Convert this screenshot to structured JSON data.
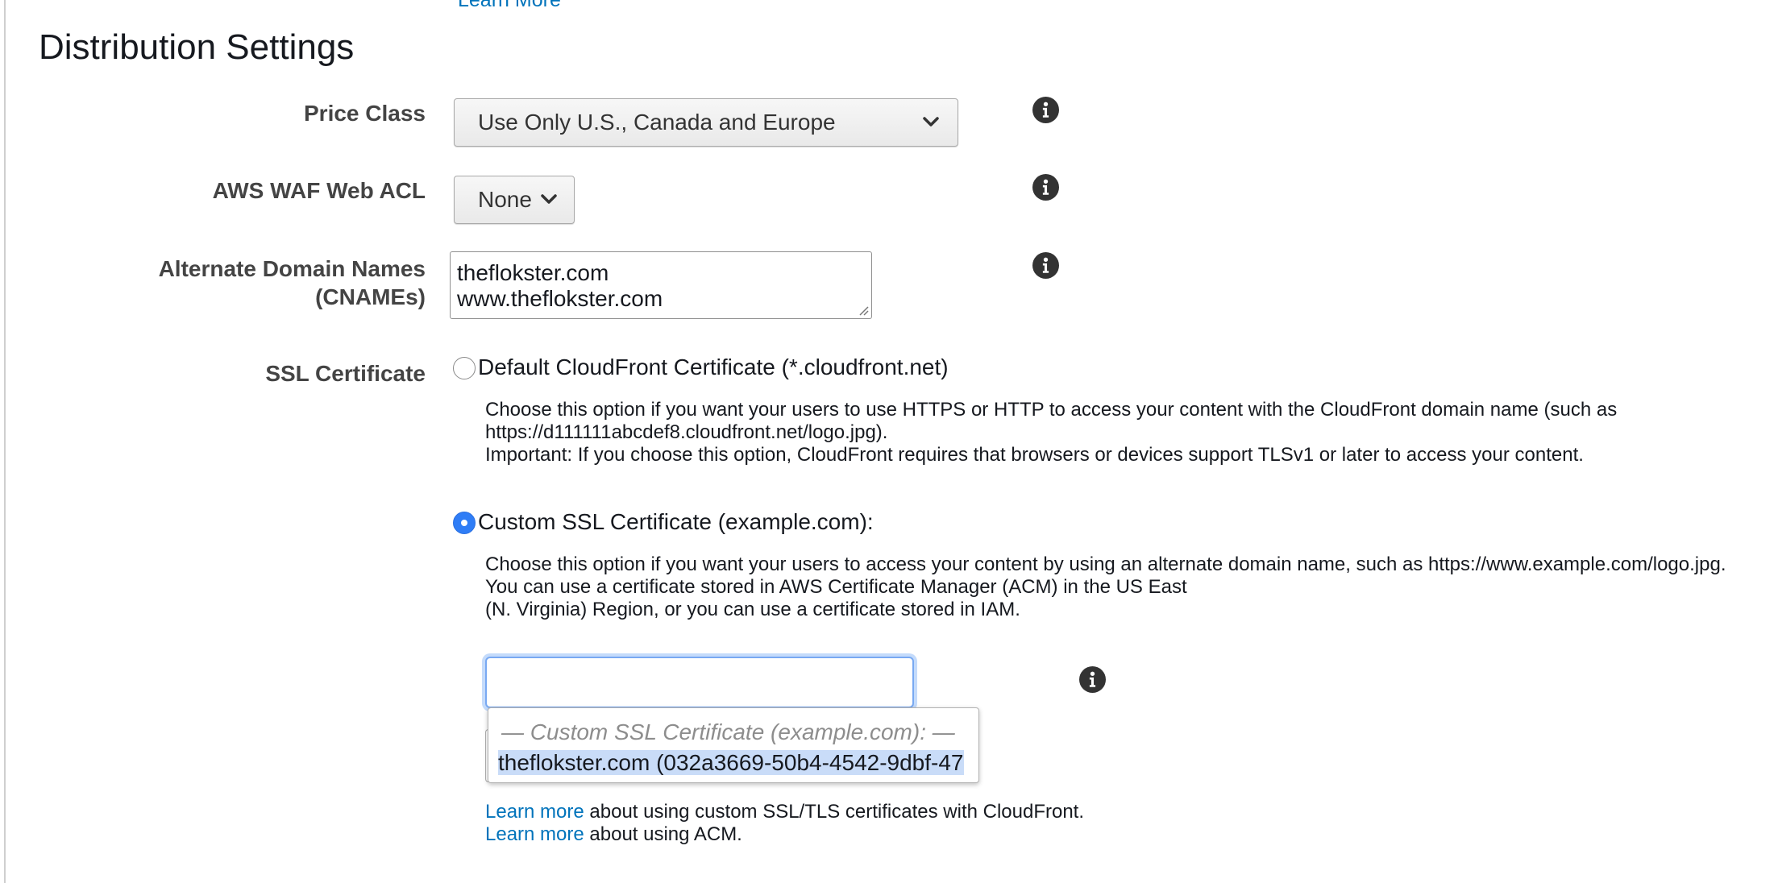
{
  "top_link": "Learn More",
  "section_title": "Distribution Settings",
  "price_class": {
    "label": "Price Class",
    "value": "Use Only U.S., Canada and Europe"
  },
  "waf": {
    "label": "AWS WAF Web ACL",
    "value": "None"
  },
  "cnames": {
    "label_line1": "Alternate Domain Names",
    "label_line2": "(CNAMEs)",
    "line1": "theflokster.com",
    "line2": "www.theflokster.com"
  },
  "ssl": {
    "label": "SSL Certificate",
    "default_option": {
      "label": "Default CloudFront Certificate (*.cloudfront.net)",
      "selected": false,
      "desc_line1": "Choose this option if you want your users to use HTTPS or HTTP to access your content with the CloudFront domain name (such as",
      "desc_line2": "https://d111111abcdef8.cloudfront.net/logo.jpg).",
      "desc_line3": "Important: If you choose this option, CloudFront requires that browsers or devices support TLSv1 or later to access your content."
    },
    "custom_option": {
      "label": "Custom SSL Certificate (example.com):",
      "selected": true,
      "desc_line1": "Choose this option if you want your users to access your content by using an alternate domain name, such as https://www.example.com/logo.jpg.",
      "desc_line2": "You can use a certificate stored in AWS Certificate Manager (ACM) in the US East",
      "desc_line3": "(N. Virginia) Region, or you can use a certificate stored in IAM."
    },
    "certificate_input_value": "",
    "dropdown": {
      "header": "— Custom SSL Certificate (example.com): —",
      "option": "theflokster.com (032a3669-50b4-4542-9dbf-47"
    },
    "learn_more_1": {
      "link": "Learn more",
      "text": " about using custom SSL/TLS certificates with CloudFront."
    },
    "learn_more_2": {
      "link": "Learn more",
      "text": " about using ACM."
    }
  },
  "colors": {
    "link": "#0073bb",
    "radio_selected": "#2f7df6",
    "focus_ring": "#78a9f2",
    "highlight": "#c9dcf8"
  },
  "icons": {
    "info": "info-icon",
    "chevron": "chevron-down-icon"
  }
}
